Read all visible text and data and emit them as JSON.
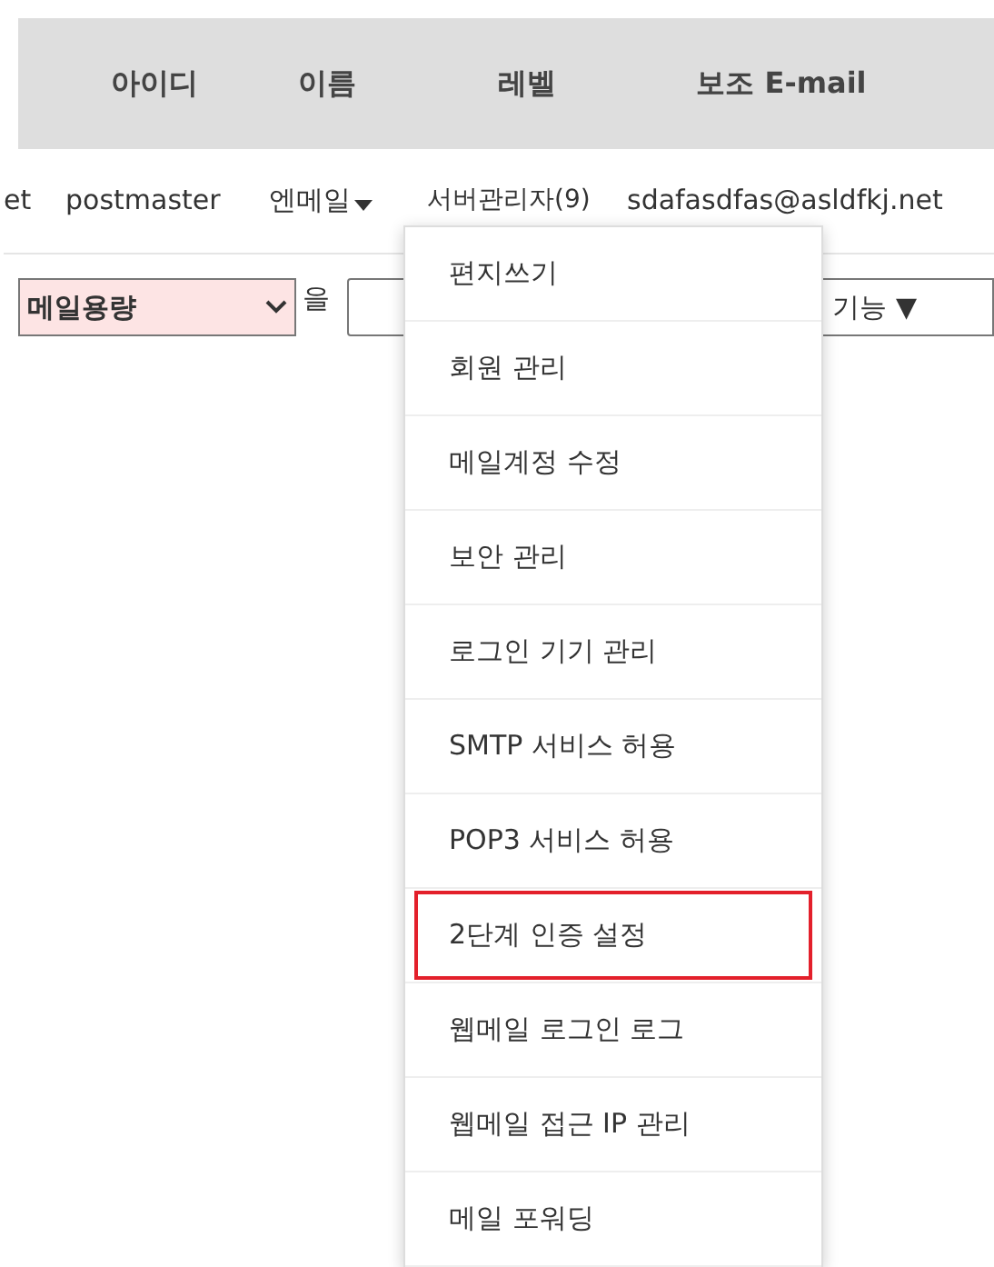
{
  "table": {
    "columns": [
      "아이디",
      "이름",
      "레벨",
      "보조 E-mail"
    ],
    "row": {
      "cell_1": "et",
      "id": "postmaster",
      "name": "엔메일",
      "level": "서버관리자(9)",
      "email": "sdafasdfas@asldfkj.net"
    }
  },
  "search": {
    "field_select": "메일용량",
    "particle": "을",
    "function_button": "기능 ▼"
  },
  "menu": {
    "items": [
      {
        "label": "편지쓰기",
        "selected": false
      },
      {
        "label": "회원 관리",
        "selected": false
      },
      {
        "label": "메일계정 수정",
        "selected": false
      },
      {
        "label": "보안 관리",
        "selected": false
      },
      {
        "label": "로그인 기기 관리",
        "selected": false
      },
      {
        "label": "SMTP 서비스 허용",
        "selected": false
      },
      {
        "label": "POP3 서비스 허용",
        "selected": false
      },
      {
        "label": "2단계 인증 설정",
        "selected": true
      },
      {
        "label": "웹메일 로그인 로그",
        "selected": false
      },
      {
        "label": "웹메일 접근 IP 관리",
        "selected": false
      },
      {
        "label": "메일 포워딩",
        "selected": false
      }
    ]
  }
}
